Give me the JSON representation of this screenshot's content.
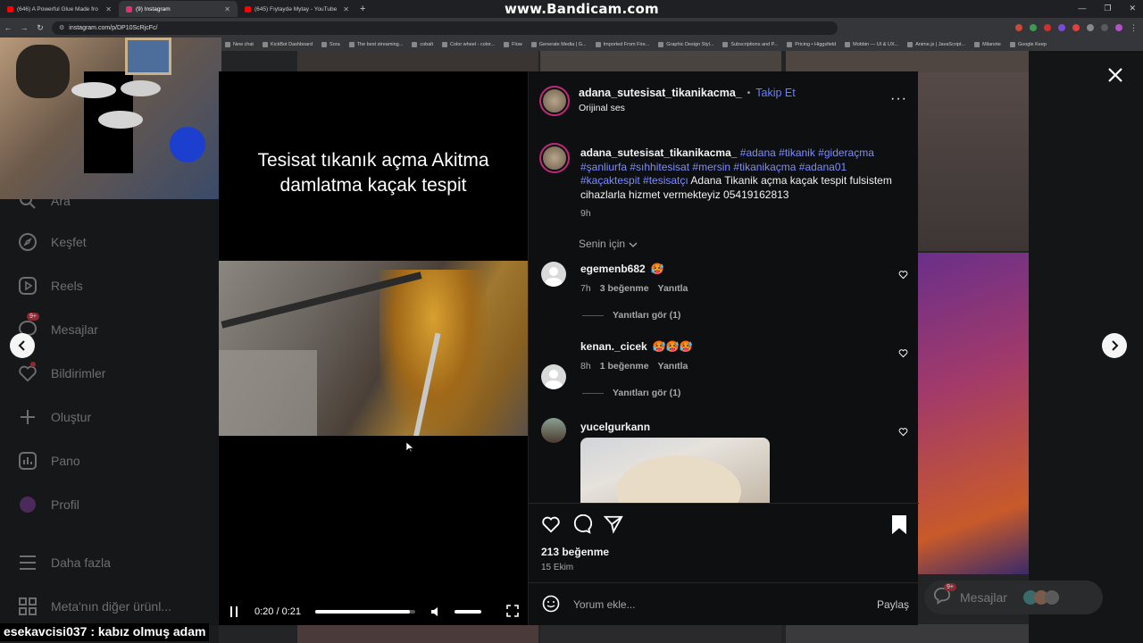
{
  "browser": {
    "tabs": [
      {
        "label": "(646) A Powerful Glue Made fro",
        "icon": "youtube-icon",
        "active": false,
        "color": "#ff0000"
      },
      {
        "label": "(9) Instagram",
        "icon": "instagram-icon",
        "active": true,
        "color": "#e1306c"
      },
      {
        "label": "(645) Fıytaydə Mytay - YouTube",
        "icon": "youtube-icon",
        "active": false,
        "color": "#ff0000"
      }
    ],
    "url": "instagram.com/p/DP10ScRjcFc/",
    "bookmarks": [
      "New chat",
      "KickBot Dashboard",
      "Sora",
      "The best streaming...",
      "cobalt",
      "Color wheel - color...",
      "Flow",
      "Generate Media | G...",
      "Imported From Fire...",
      "Graphic Design Styl...",
      "Subscriptions and P...",
      "Pricing • Higgsfield",
      "Mobbin — UI & UX...",
      "Anime.js | JavaScript...",
      "Milanote",
      "Google Keep"
    ]
  },
  "watermark": "www.Bandicam.com",
  "sidebar": {
    "items": [
      {
        "label": "Ara",
        "icon": "search-icon"
      },
      {
        "label": "Keşfet",
        "icon": "compass-icon"
      },
      {
        "label": "Reels",
        "icon": "reels-icon"
      },
      {
        "label": "Mesajlar",
        "icon": "messenger-icon",
        "badge": "9+"
      },
      {
        "label": "Bildirimler",
        "icon": "heart-icon"
      },
      {
        "label": "Oluştur",
        "icon": "plus-icon"
      },
      {
        "label": "Pano",
        "icon": "dashboard-icon"
      },
      {
        "label": "Profil",
        "icon": "profile-avatar"
      }
    ],
    "more": "Daha fazla",
    "meta": "Meta'nın diğer ürünl..."
  },
  "video": {
    "caption": "Tesisat tıkanık açma Akitma damlatma kaçak tespit",
    "time": "0:20 / 0:21",
    "progress": 0.95
  },
  "post": {
    "author": "adana_sutesisat_tikanikacma_",
    "follow": "Takip Et",
    "audio": "Orijinal ses",
    "caption_user": "adana_sutesisat_tikanikacma_",
    "hashtags": "#adana #tikanik #gideraçma #şanliurfa #sıhhitesisat #mersin #tikanikaçma #adana01 #kaçaktespit #tesisatçı",
    "caption_text": "Adana Tikanik açma kaçak tespit fulsistem cihazlarla hizmet vermekteyiz 05419162813",
    "caption_time": "9h",
    "sort_label": "Senin için",
    "likes": "213 beğenme",
    "date": "15 Ekim",
    "comment_placeholder": "Yorum ekle...",
    "share": "Paylaş"
  },
  "comments": [
    {
      "user": "egemenb682",
      "emoji": "🥵",
      "time": "7h",
      "likes": "3 beğenme",
      "reply": "Yanıtla",
      "replies": "Yanıtları gör (1)"
    },
    {
      "user": "kenan._cicek",
      "emoji": "🥵🥵🥵",
      "time": "8h",
      "likes": "1 beğenme",
      "reply": "Yanıtla",
      "replies": "Yanıtları gör (1)"
    },
    {
      "user": "yucelgurkann"
    }
  ],
  "background_messages": {
    "label": "Mesajlar",
    "badge": "9+"
  },
  "chat_overlay": "esekavcisi037 : kabız olmuş adam"
}
